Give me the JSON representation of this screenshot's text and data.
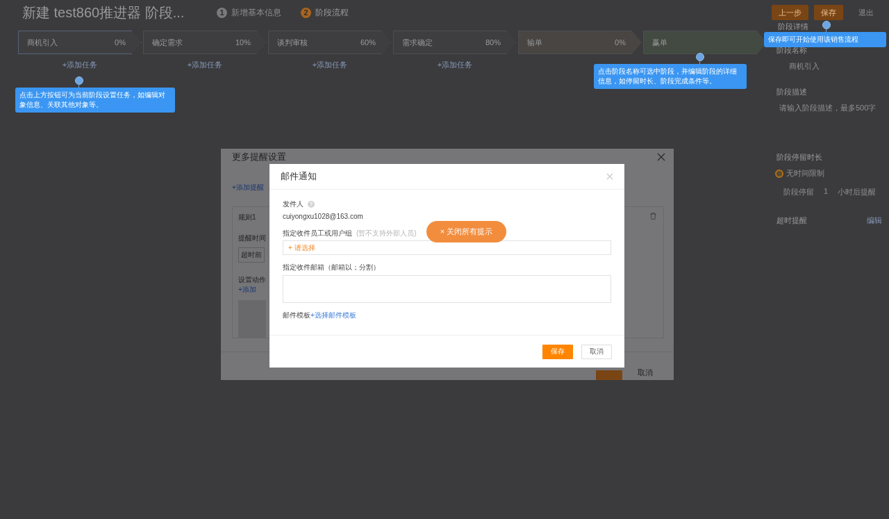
{
  "header": {
    "title": "新建 test860推进器 阶段...",
    "steps": [
      {
        "number": "1",
        "label": "新增基本信息",
        "selected": false
      },
      {
        "number": "2",
        "label": "阶段流程",
        "selected": true
      }
    ],
    "buttons": [
      {
        "label": "上一步",
        "kind": "primary"
      },
      {
        "label": "保存",
        "kind": "primary"
      },
      {
        "label": "退出",
        "kind": "plain"
      }
    ]
  },
  "stages": [
    {
      "name": "商机引入",
      "percent": "0%",
      "kind": "open",
      "selected": true,
      "task": "+添加任务"
    },
    {
      "name": "确定需求",
      "percent": "10%",
      "kind": "open",
      "selected": false,
      "task": "+添加任务"
    },
    {
      "name": "谈判审核",
      "percent": "60%",
      "kind": "open",
      "selected": false,
      "task": "+添加任务"
    },
    {
      "name": "需求确定",
      "percent": "80%",
      "kind": "open",
      "selected": false,
      "task": "+添加任务"
    },
    {
      "name": "输单",
      "percent": "0%",
      "kind": "lost",
      "selected": false
    },
    {
      "name": "赢单",
      "kind": "won",
      "selected": false
    }
  ],
  "side_panel": {
    "tab": "阶段详情",
    "name_label": "阶段名称",
    "name_value": "商机引入",
    "desc_label": "阶段描述",
    "desc_placeholder": "请输入阶段描述，最多500字",
    "duration_label": "阶段停留时长",
    "options": [
      {
        "label": "无时间限制",
        "selected": true
      }
    ],
    "stay_label": "阶段停留",
    "stay_value": "1",
    "stay_suffix": "小时后提醒",
    "overtime_label": "超时提醒",
    "edit_link": "编辑"
  },
  "tips": [
    {
      "text": "点击上方按钮可为当前阶段设置任务，如编辑对象信息、关联其他对象等。"
    },
    {
      "text": "点击阶段名称可选中阶段，并编辑阶段的详细信息，如停留时长、阶段完成条件等。"
    },
    {
      "text": "保存即可开始使用该销售流程"
    }
  ],
  "reminder_dialog": {
    "title": "更多提醒设置",
    "add_rule": "+添加提醒",
    "rule": {
      "title": "规则1",
      "time_label": "提醒时间",
      "time_value": "超时前",
      "action_label": "设置动作",
      "add_action": "+添加"
    },
    "cancel": "取消"
  },
  "mail_dialog": {
    "title": "邮件通知",
    "sender_label": "发件人",
    "sender": "cuiyongxu1028@163.com",
    "recipients_label": "指定收件员工或用户组",
    "recipients_hint": "(暂不支持外部人员)",
    "recipients_picker": "+ 请选择",
    "emails_label": "指定收件邮箱（邮箱以；分割）",
    "template_label": "邮件模板",
    "template_link": "+选择邮件模板",
    "buttons": [
      {
        "label": "保存",
        "kind": "primary"
      },
      {
        "label": "取消",
        "kind": "secondary"
      }
    ]
  },
  "close_tips": "× 关闭所有提示"
}
